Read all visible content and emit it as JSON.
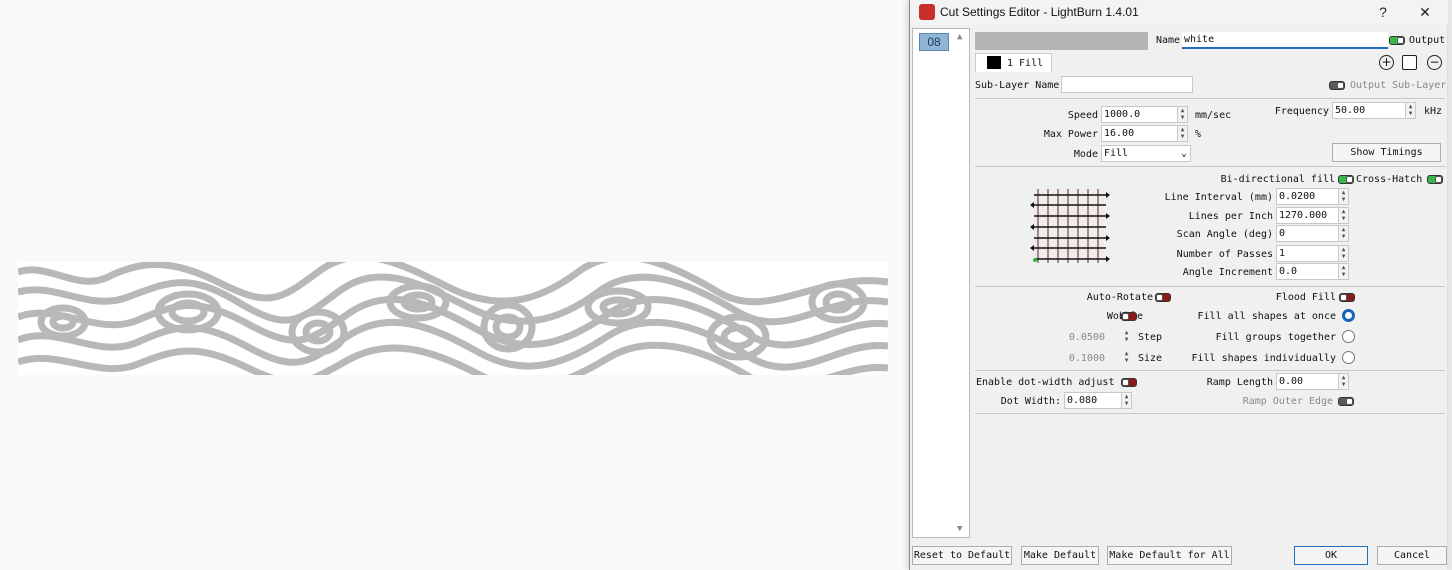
{
  "window": {
    "title": "Cut Settings Editor - LightBurn 1.4.01",
    "help": "?",
    "close": "✕"
  },
  "layer_list": {
    "items": [
      "08"
    ]
  },
  "header": {
    "name_label": "Name",
    "name_value": "white",
    "output_label": "Output",
    "layer_color": "#b4b4b4"
  },
  "sublayer_tab": {
    "label": "1 Fill",
    "swatch_color": "#000000"
  },
  "sublayer": {
    "name_label": "Sub-Layer Name",
    "name_value": "",
    "output_sublayer_label": "Output Sub-Layer"
  },
  "main": {
    "speed_label": "Speed",
    "speed_value": "1000.0",
    "speed_unit": "mm/sec",
    "power_label": "Max Power",
    "power_value": "16.00",
    "power_unit": "%",
    "mode_label": "Mode",
    "mode_value": "Fill",
    "frequency_label": "Frequency",
    "frequency_value": "50.00",
    "frequency_unit": "kHz",
    "show_timings": "Show Timings"
  },
  "fill": {
    "bidir_label": "Bi-directional fill",
    "crosshatch_label": "Cross-Hatch",
    "interval_label": "Line Interval (mm)",
    "interval_value": "0.0200",
    "lpi_label": "Lines per Inch",
    "lpi_value": "1270.000",
    "angle_label": "Scan Angle (deg)",
    "angle_value": "0",
    "passes_label": "Number of Passes",
    "passes_value": "1",
    "increment_label": "Angle Increment",
    "increment_value": "0.0"
  },
  "options": {
    "autorotate_label": "Auto-Rotate",
    "floodfill_label": "Flood Fill",
    "wobble_label": "Wobble",
    "fill_all_label": "Fill all shapes at once",
    "step_value": "0.0500",
    "step_label": "Step",
    "fill_groups_label": "Fill groups together",
    "size_value": "0.1000",
    "size_label": "Size",
    "fill_individual_label": "Fill shapes individually"
  },
  "dot": {
    "enable_label": "Enable dot-width adjust",
    "ramp_label": "Ramp Length",
    "ramp_value": "0.00",
    "width_label": "Dot Width:",
    "width_value": "0.080",
    "ramp_outer_label": "Ramp Outer Edge"
  },
  "footer": {
    "reset": "Reset to Default",
    "make_default": "Make Default",
    "make_default_all": "Make Default for All",
    "ok": "OK",
    "cancel": "Cancel"
  }
}
